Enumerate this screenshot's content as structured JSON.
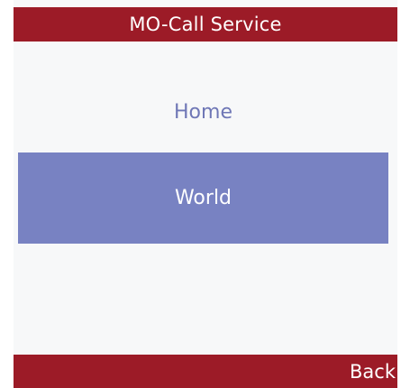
{
  "window": {
    "title": "MO-Call Service"
  },
  "menu": {
    "items": [
      {
        "label": "Home",
        "selected": false
      },
      {
        "label": "World",
        "selected": true
      }
    ]
  },
  "softkeys": {
    "right_label": "Back"
  },
  "colors": {
    "title_bar": "#9c1b27",
    "selection": "#7882c2",
    "unselected_text": "#6f77b6",
    "background": "#f7f8f9"
  }
}
